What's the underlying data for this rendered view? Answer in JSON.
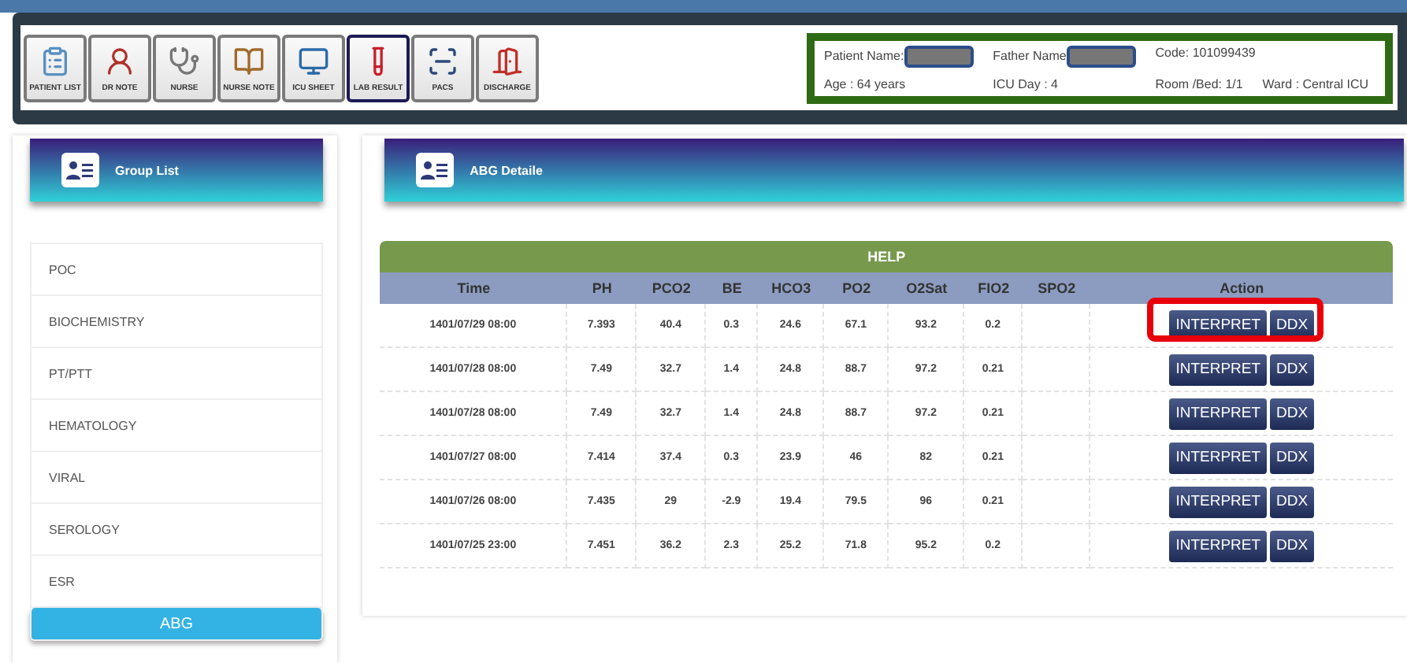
{
  "toolbar": [
    {
      "label": "PATIENT LIST",
      "selected": false
    },
    {
      "label": "DR NOTE",
      "selected": false
    },
    {
      "label": "NURSE",
      "selected": false
    },
    {
      "label": "NURSE NOTE",
      "selected": false
    },
    {
      "label": "ICU SHEET",
      "selected": false
    },
    {
      "label": "LAB RESULT",
      "selected": true
    },
    {
      "label": "PACS",
      "selected": false
    },
    {
      "label": "DISCHARGE",
      "selected": false
    }
  ],
  "patient": {
    "name_label": "Patient Name:",
    "name_redacted": true,
    "father_label": "Father Name",
    "father_redacted": true,
    "code": "Code: 101099439",
    "age": "Age : 64 years",
    "icu_day": "ICU Day : 4",
    "room": "Room /Bed: 1/1",
    "ward": "Ward : Central ICU"
  },
  "group_list": {
    "title": "Group List",
    "items": [
      {
        "label": "POC",
        "selected": false
      },
      {
        "label": "BIOCHEMISTRY",
        "selected": false
      },
      {
        "label": "PT/PTT",
        "selected": false
      },
      {
        "label": "HEMATOLOGY",
        "selected": false
      },
      {
        "label": "VIRAL",
        "selected": false
      },
      {
        "label": "SEROLOGY",
        "selected": false
      },
      {
        "label": "ESR",
        "selected": false
      },
      {
        "label": "ABG",
        "selected": true
      }
    ]
  },
  "detail": {
    "title": "ABG Detaile",
    "help": "HELP",
    "columns": [
      "Time",
      "PH",
      "PCO2",
      "BE",
      "HCO3",
      "PO2",
      "O2Sat",
      "FIO2",
      "SPO2",
      "Action"
    ],
    "rows": [
      {
        "cells": [
          "1401/07/29 08:00",
          "7.393",
          "40.4",
          "0.3",
          "24.6",
          "67.1",
          "93.2",
          "0.2",
          ""
        ],
        "actions": [
          "INTERPRET",
          "DDX"
        ],
        "highlighted": true
      },
      {
        "cells": [
          "1401/07/28 08:00",
          "7.49",
          "32.7",
          "1.4",
          "24.8",
          "88.7",
          "97.2",
          "0.21",
          ""
        ],
        "actions": [
          "INTERPRET",
          "DDX"
        ],
        "highlighted": false
      },
      {
        "cells": [
          "1401/07/28 08:00",
          "7.49",
          "32.7",
          "1.4",
          "24.8",
          "88.7",
          "97.2",
          "0.21",
          ""
        ],
        "actions": [
          "INTERPRET",
          "DDX"
        ],
        "highlighted": false
      },
      {
        "cells": [
          "1401/07/27 08:00",
          "7.414",
          "37.4",
          "0.3",
          "23.9",
          "46",
          "82",
          "0.21",
          ""
        ],
        "actions": [
          "INTERPRET",
          "DDX"
        ],
        "highlighted": false
      },
      {
        "cells": [
          "1401/07/26 08:00",
          "7.435",
          "29",
          "-2.9",
          "19.4",
          "79.5",
          "96",
          "0.21",
          ""
        ],
        "actions": [
          "INTERPRET",
          "DDX"
        ],
        "highlighted": false
      },
      {
        "cells": [
          "1401/07/25 23:00",
          "7.451",
          "36.2",
          "2.3",
          "25.2",
          "71.8",
          "95.2",
          "0.2",
          ""
        ],
        "actions": [
          "INTERPRET",
          "DDX"
        ],
        "highlighted": false
      }
    ]
  }
}
